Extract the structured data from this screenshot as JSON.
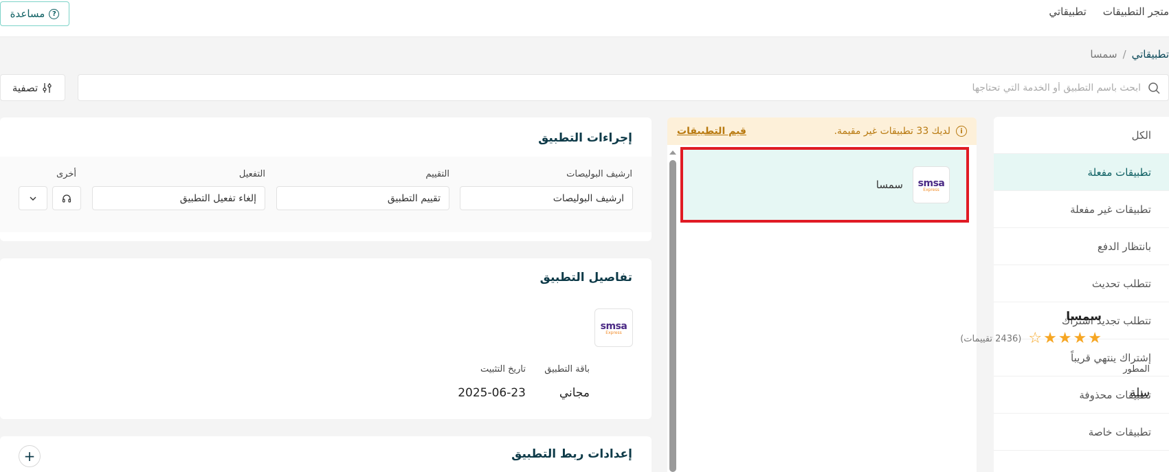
{
  "header": {
    "nav": [
      "متجر التطبيقات",
      "تطبيقاتي"
    ],
    "help_label": "مساعدة"
  },
  "breadcrumb": {
    "root": "تطبيقاتي",
    "separator": "/",
    "current": "سمسا"
  },
  "search": {
    "placeholder": "ابحث باسم التطبيق أو الخدمة التي تحتاجها"
  },
  "filter": {
    "label": "تصفية"
  },
  "sidebar": {
    "items": [
      {
        "label": "الكل"
      },
      {
        "label": "تطبيقات مفعلة"
      },
      {
        "label": "تطبيقات غير مفعلة"
      },
      {
        "label": "بانتظار الدفع"
      },
      {
        "label": "تتطلب تحديث"
      },
      {
        "label": "تتطلب تجديد اشتراك"
      },
      {
        "label": "إشتراك ينتهي قريباً"
      },
      {
        "label": "تطبيقات محذوفة"
      },
      {
        "label": "تطبيقات خاصة"
      }
    ],
    "active_index": 1
  },
  "notice": {
    "message": "لديك 33 تطبيقات غير مقيمة.",
    "action": "قيم التطبيقات"
  },
  "app_list": [
    {
      "name": "سمسا",
      "logo_text": "smsa",
      "logo_sub": "Express"
    }
  ],
  "actions": {
    "title": "إجراءات التطبيق",
    "fields": [
      {
        "label": "ارشيف البوليصات",
        "value": "ارشيف البوليصات"
      },
      {
        "label": "التقييم",
        "value": "تقييم التطبيق"
      },
      {
        "label": "التفعيل",
        "value": "إلغاء تفعيل التطبيق"
      }
    ],
    "other_label": "أخرى"
  },
  "details": {
    "title": "تفاصيل التطبيق",
    "name": "سمسا",
    "rating": 4,
    "rating_count": "(2436 تقييمات)",
    "meta": [
      {
        "label": "المطور",
        "value": "سلة"
      },
      {
        "label": "باقة التطبيق",
        "value": "مجاني"
      },
      {
        "label": "تاريخ التثبيت",
        "value": "2025-06-23"
      }
    ]
  },
  "link_settings": {
    "title": "إعدادات ربط التطبيق"
  },
  "colors": {
    "primary": "#0d5f62",
    "active_bg": "#e6f7f4",
    "notice_bg": "#fdf0d9",
    "notice_text": "#b8790f",
    "highlight_border": "#e01b24",
    "star": "#f6a623"
  }
}
